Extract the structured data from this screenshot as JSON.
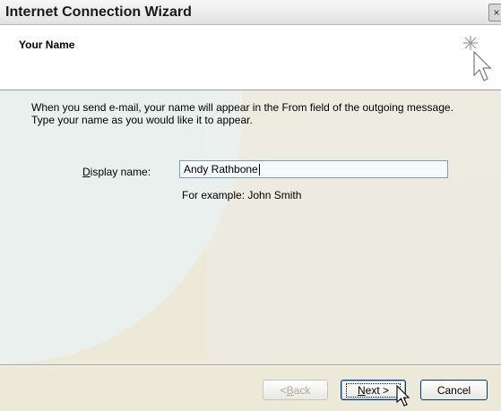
{
  "window": {
    "title": "Internet Connection Wizard",
    "close_glyph": "×"
  },
  "header": {
    "title": "Your Name",
    "icon": "wizard-cursor-sparkle-icon"
  },
  "body": {
    "intro_line1": "When you send e-mail, your name will appear in the From field of the outgoing message.",
    "intro_line2": "Type your name as you would like it to appear.",
    "display_name_label_prefix": "D",
    "display_name_label_rest": "isplay name:",
    "display_name_value": "Andy Rathbone",
    "example_text": "For example: John Smith"
  },
  "buttons": {
    "back_prefix": "< ",
    "back_access": "B",
    "back_rest": "ack",
    "next_access": "N",
    "next_rest": "ext >",
    "cancel": "Cancel"
  },
  "colors": {
    "dialog_bg": "#ece9d8",
    "accent_border": "#003c74",
    "input_border": "#7f9db9"
  }
}
